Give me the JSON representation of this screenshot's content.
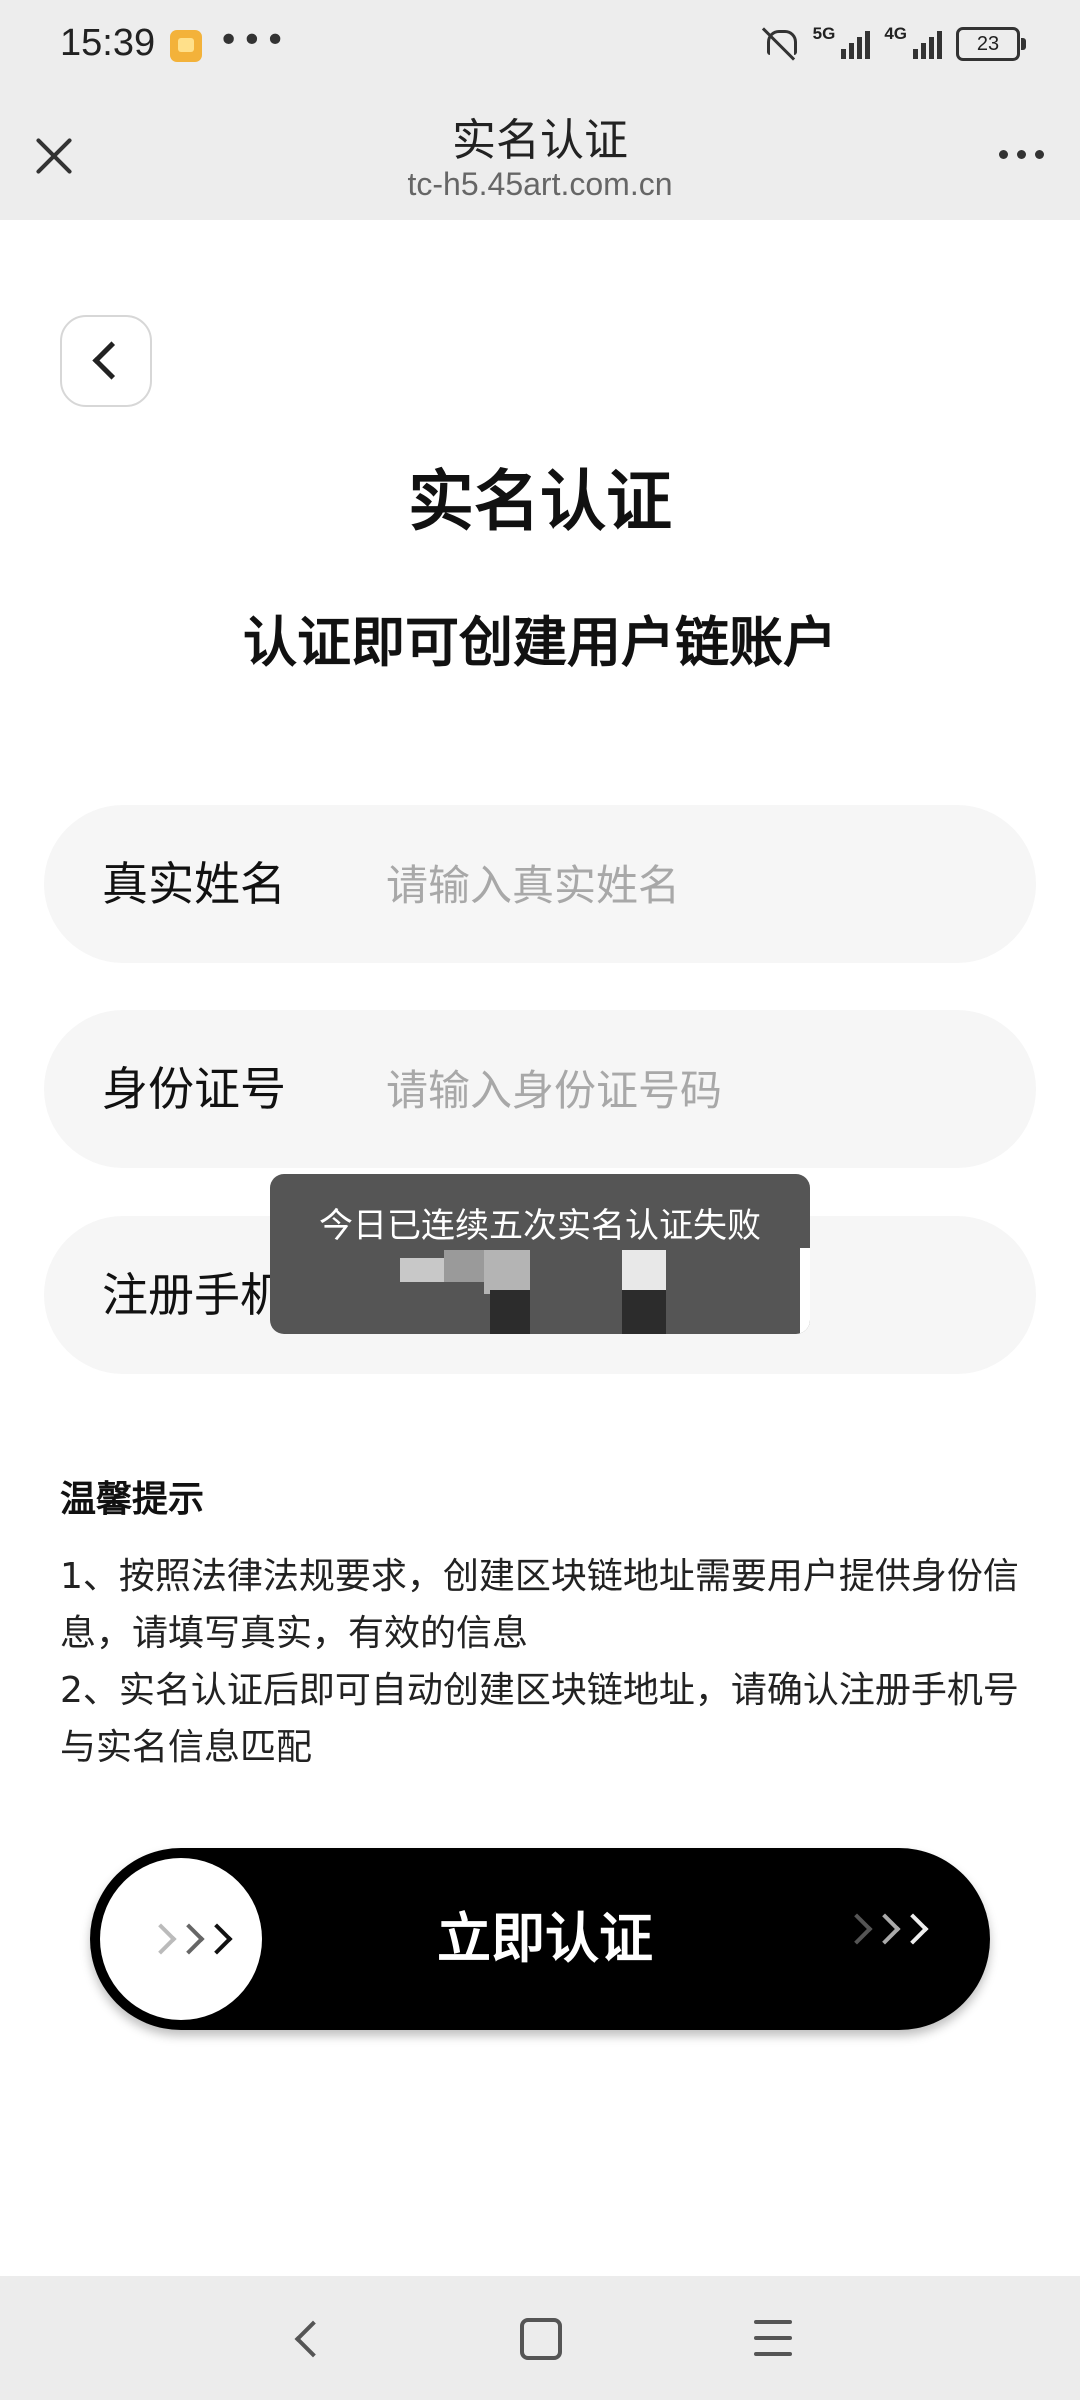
{
  "status_bar": {
    "time": "15:39",
    "notification_dots": "•••",
    "network_5g": "5G",
    "network_4g": "4G",
    "battery": "23"
  },
  "browser": {
    "title": "实名认证",
    "url": "tc-h5.45art.com.cn"
  },
  "page": {
    "title": "实名认证",
    "subtitle": "认证即可创建用户链账户"
  },
  "form": {
    "name": {
      "label": "真实姓名",
      "placeholder": "请输入真实姓名",
      "value": ""
    },
    "id_number": {
      "label": "身份证号",
      "placeholder": "请输入身份证号码",
      "value": ""
    },
    "phone": {
      "label": "注册手机",
      "placeholder": "",
      "value": ""
    }
  },
  "toast": {
    "message": "今日已连续五次实名认证失败"
  },
  "tips": {
    "title": "温馨提示",
    "line1": "1、按照法律法规要求，创建区块链地址需要用户提供身份信息，请填写真实，有效的信息",
    "line2": "2、实名认证后即可自动创建区块链地址，请确认注册手机号与实名信息匹配"
  },
  "action": {
    "label": "立即认证"
  },
  "colors": {
    "accent": "#000000",
    "field_background": "#f6f6f6",
    "toast_background": "#555555",
    "placeholder": "#a8a8a8"
  }
}
